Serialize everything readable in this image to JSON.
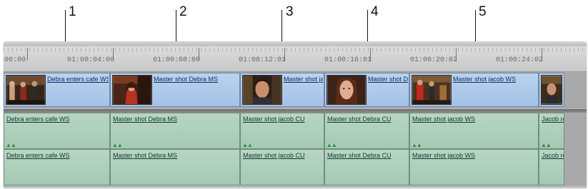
{
  "callouts": [
    "1",
    "2",
    "3",
    "4",
    "5"
  ],
  "timecodes": [
    "00:00",
    "01:00:04:00",
    "01:00:08:00",
    "01:00:12:01",
    "01:00:16:01",
    "01:00:20:02",
    "01:00:24:02"
  ],
  "video_clips": [
    {
      "name": "Debra enters cafe WS",
      "thumb": "cafe-wide-shot"
    },
    {
      "name": "Master shot Debra MS",
      "thumb": "debra-medium-shot"
    },
    {
      "name": "Master shot jacob CU",
      "thumb": "jacob-closeup"
    },
    {
      "name": "Master shot Debra CU",
      "thumb": "debra-closeup"
    },
    {
      "name": "Master shot jacob WS",
      "thumb": "jacob-wide-shot"
    },
    {
      "name": "",
      "thumb": "jacob-partial"
    }
  ],
  "audio_track_1": [
    "Debra enters cafe WS",
    "Master shot Debra MS",
    "Master shot jacob CU",
    "Master shot Debra CU",
    "Master shot jacob WS",
    "Jacob re"
  ],
  "audio_track_2": [
    "Debra enters cafe WS",
    "Master shot Debra MS",
    "Master shot jacob CU",
    "Master shot Debra CU",
    "Master shot jacob WS",
    "Jacob re"
  ],
  "link_marker": "▲▲",
  "colors": {
    "video_clip": "#a9c7e9",
    "audio_clip": "#a8cbb7",
    "track_background": "#a9a9a9",
    "ruler": "#d2d2d2"
  }
}
